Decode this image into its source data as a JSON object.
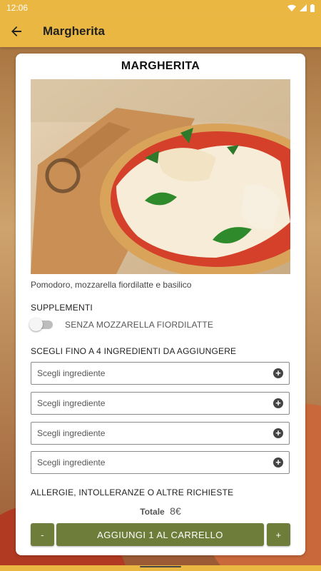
{
  "status_bar": {
    "time": "12:06",
    "icons": [
      "wifi-icon",
      "signal-icon",
      "battery-icon"
    ]
  },
  "app_bar": {
    "title": "Margherita",
    "back_icon": "arrow-back-icon"
  },
  "product": {
    "name": "MARGHERITA",
    "description": "Pomodoro, mozzarella fiordilatte e basilico"
  },
  "supplements": {
    "heading": "SUPPLEMENTI",
    "options": [
      {
        "label": "SENZA MOZZARELLA FIORDILATTE",
        "enabled": false
      }
    ]
  },
  "ingredients": {
    "heading": "SCEGLI FINO A 4 INGREDIENTI DA AGGIUNGERE",
    "selects": [
      {
        "placeholder": "Scegli ingrediente"
      },
      {
        "placeholder": "Scegli ingrediente"
      },
      {
        "placeholder": "Scegli ingrediente"
      },
      {
        "placeholder": "Scegli ingrediente"
      }
    ]
  },
  "allergies": {
    "heading": "ALLERGIE, INTOLLERANZE O ALTRE RICHIESTE"
  },
  "total": {
    "label": "Totale",
    "value": "8€"
  },
  "cart": {
    "minus": "-",
    "add_label": "AGGIUNGI 1 AL CARRELLO",
    "plus": "+"
  },
  "colors": {
    "accent": "#eab743",
    "button": "#6f7d3a"
  }
}
